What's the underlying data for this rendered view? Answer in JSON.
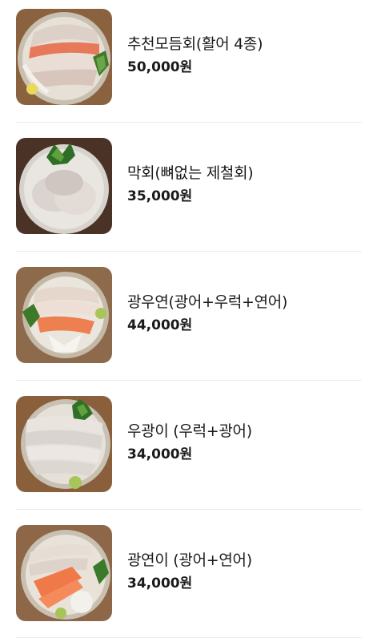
{
  "menu": {
    "items": [
      {
        "name": "추천모듬회(활어 4종)",
        "price": "50,000원",
        "image": "assorted-sashimi-platter"
      },
      {
        "name": "막회(뼈없는 제철회)",
        "price": "35,000원",
        "image": "makhoe-platter"
      },
      {
        "name": "광우연(광어+우럭+연어)",
        "price": "44,000원",
        "image": "flatfish-rockfish-salmon-platter"
      },
      {
        "name": "우광이 (우럭+광어)",
        "price": "34,000원",
        "image": "rockfish-flatfish-platter"
      },
      {
        "name": "광연이 (광어+연어)",
        "price": "34,000원",
        "image": "flatfish-salmon-platter"
      }
    ]
  }
}
